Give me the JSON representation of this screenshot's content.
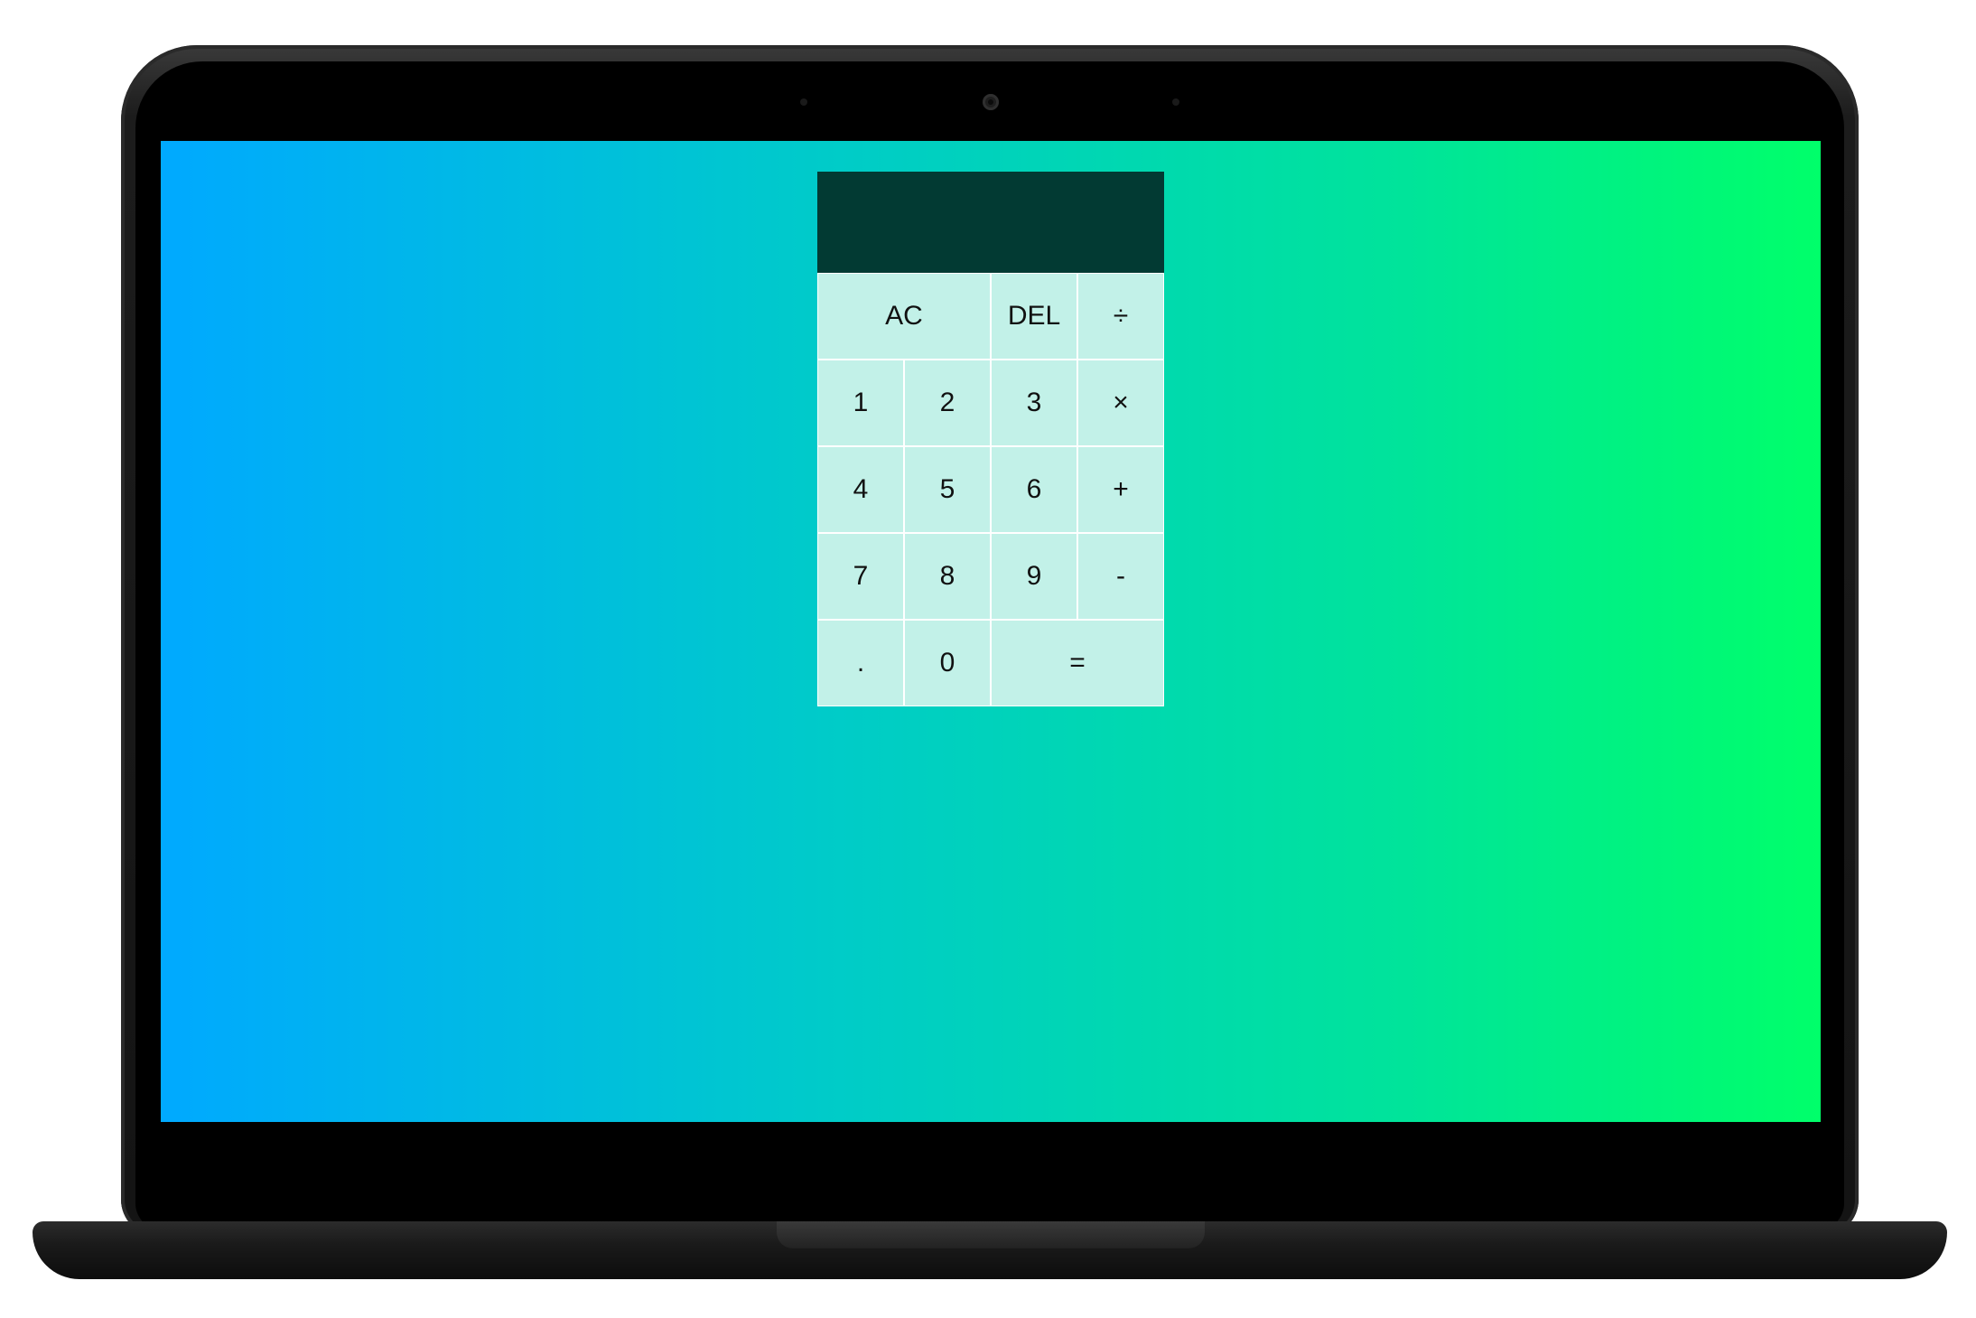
{
  "calculator": {
    "previous_operand": "",
    "current_operand": "",
    "keys": {
      "all_clear": "AC",
      "delete": "DEL",
      "divide": "÷",
      "one": "1",
      "two": "2",
      "three": "3",
      "multiply": "×",
      "four": "4",
      "five": "5",
      "six": "6",
      "plus": "+",
      "seven": "7",
      "eight": "8",
      "nine": "9",
      "minus": "-",
      "decimal": ".",
      "zero": "0",
      "equals": "="
    }
  },
  "colors": {
    "background_gradient_start": "#00a9ff",
    "background_gradient_end": "#00ff6a",
    "display_background": "#023a33",
    "key_background": "#c2f1e8",
    "key_border": "#ffffff",
    "laptop_body": "#141414"
  }
}
